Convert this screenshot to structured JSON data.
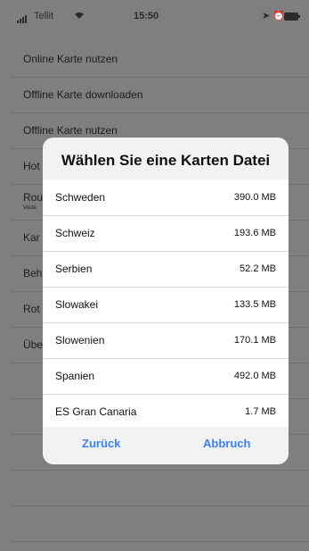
{
  "status": {
    "carrier": "Tellit",
    "time": "15:50"
  },
  "menu": [
    {
      "label": "Online Karte nutzen"
    },
    {
      "label": "Offline Karte downloaden"
    },
    {
      "label": "Offline Karte nutzen"
    },
    {
      "label": "Hot"
    },
    {
      "label": "Rou",
      "sub": "Vaste"
    },
    {
      "label": "Kar"
    },
    {
      "label": "Beh"
    },
    {
      "label": "Rot"
    },
    {
      "label": "Übe"
    }
  ],
  "dialog": {
    "title": "Wählen Sie eine Karten Datei",
    "files": [
      {
        "name": "Schweden",
        "size": "390.0 MB"
      },
      {
        "name": "Schweiz",
        "size": "193.6 MB"
      },
      {
        "name": "Serbien",
        "size": "52.2 MB"
      },
      {
        "name": "Slowakei",
        "size": "133.5 MB"
      },
      {
        "name": "Slowenien",
        "size": "170.1 MB"
      },
      {
        "name": "Spanien",
        "size": "492.0 MB"
      },
      {
        "name": "ES Gran Canaria",
        "size": "1.7 MB"
      }
    ],
    "back_label": "Zurück",
    "cancel_label": "Abbruch"
  },
  "icons": [
    "signal-icon",
    "wifi-icon",
    "location-arrow-icon",
    "alarm-icon",
    "battery-icon"
  ],
  "colors": {
    "accent": "#3b82f6",
    "dim_background": "#7f7f7f",
    "dialog_background": "#f2f2f2"
  }
}
